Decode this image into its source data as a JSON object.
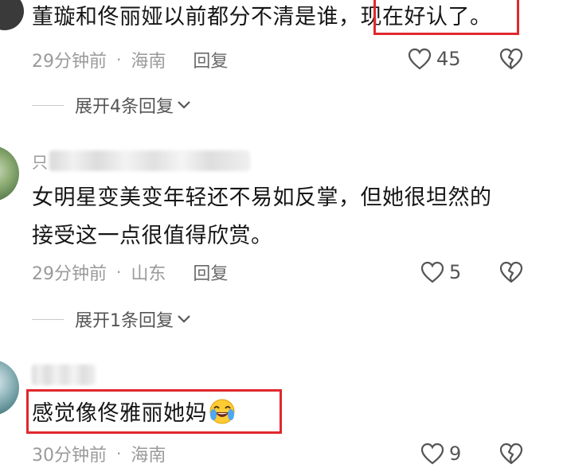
{
  "comments": [
    {
      "text_a": "董璇和佟丽娅以前都分不清是谁，",
      "text_b": "现在好认了。",
      "time": "29分钟前",
      "dot": "·",
      "location": "海南",
      "reply": "回复",
      "likes": "45",
      "expand": "展开4条回复"
    },
    {
      "user": "只",
      "line1": "女明星变美变年轻还不易如反掌，但她很坦然的",
      "line2": "接受这一点很值得欣赏。",
      "time": "29分钟前",
      "dot": "·",
      "location": "山东",
      "reply": "回复",
      "likes": "5",
      "expand": "展开1条回复"
    },
    {
      "text": "感觉像佟雅丽她妈",
      "emoji": "laughing-crying-emoji",
      "time": "30分钟前",
      "dot": "·",
      "location": "海南",
      "likes": "9"
    }
  ],
  "colors": {
    "highlight_border": "#e0282e",
    "meta_text": "#9a9a9a"
  }
}
